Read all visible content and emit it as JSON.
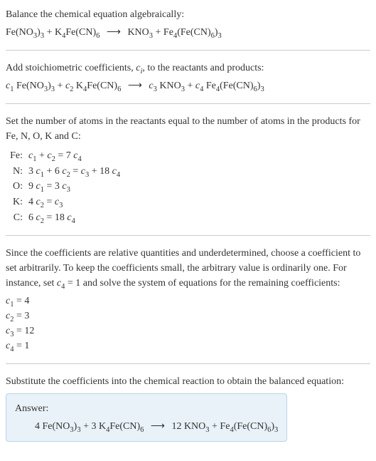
{
  "section1": {
    "title": "Balance the chemical equation algebraically:",
    "equation": "Fe(NO₃)₃ + K₄Fe(CN)₆ ⟶ KNO₃ + Fe₄(Fe(CN)₆)₃"
  },
  "section2": {
    "text_before": "Add stoichiometric coefficients, ",
    "ci": "cᵢ",
    "text_after": ", to the reactants and products:",
    "equation": "c₁ Fe(NO₃)₃ + c₂ K₄Fe(CN)₆ ⟶ c₃ KNO₃ + c₄ Fe₄(Fe(CN)₆)₃"
  },
  "section3": {
    "text": "Set the number of atoms in the reactants equal to the number of atoms in the products for Fe, N, O, K and C:",
    "atoms": [
      {
        "label": "Fe:",
        "eq": "c₁ + c₂ = 7 c₄"
      },
      {
        "label": "N:",
        "eq": "3 c₁ + 6 c₂ = c₃ + 18 c₄"
      },
      {
        "label": "O:",
        "eq": "9 c₁ = 3 c₃"
      },
      {
        "label": "K:",
        "eq": "4 c₂ = c₃"
      },
      {
        "label": "C:",
        "eq": "6 c₂ = 18 c₄"
      }
    ]
  },
  "section4": {
    "text": "Since the coefficients are relative quantities and underdetermined, choose a coefficient to set arbitrarily. To keep the coefficients small, the arbitrary value is ordinarily one. For instance, set c₄ = 1 and solve the system of equations for the remaining coefficients:",
    "coeffs": [
      "c₁ = 4",
      "c₂ = 3",
      "c₃ = 12",
      "c₄ = 1"
    ]
  },
  "section5": {
    "text": "Substitute the coefficients into the chemical reaction to obtain the balanced equation:",
    "answer_label": "Answer:",
    "answer_eq": "4 Fe(NO₃)₃ + 3 K₄Fe(CN)₆ ⟶ 12 KNO₃ + Fe₄(Fe(CN)₆)₃"
  }
}
